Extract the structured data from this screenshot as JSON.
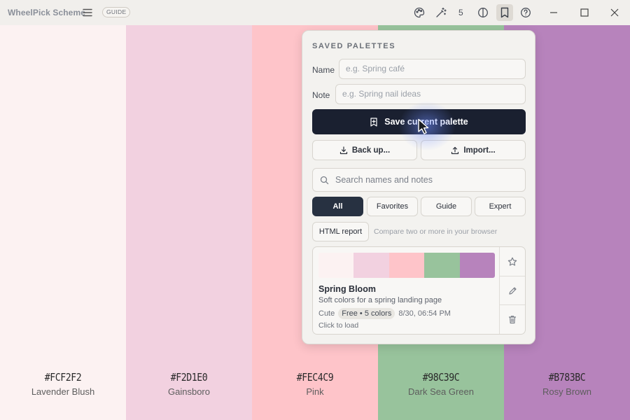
{
  "titlebar": {
    "app_title": "WheelPick Scheme",
    "guide_badge": "GUIDE",
    "saved_count": "5"
  },
  "swatches": [
    {
      "hex": "#FCF2F2",
      "name": "Lavender Blush",
      "color": "#FCF2F2"
    },
    {
      "hex": "#F2D1E0",
      "name": "Gainsboro",
      "color": "#F2D1E0"
    },
    {
      "hex": "#FEC4C9",
      "name": "Pink",
      "color": "#FEC4C9"
    },
    {
      "hex": "#98C39C",
      "name": "Dark Sea Green",
      "color": "#98C39C"
    },
    {
      "hex": "#B783BC",
      "name": "Rosy Brown",
      "color": "#B783BC"
    }
  ],
  "panel": {
    "title": "SAVED PALETTES",
    "name_label": "Name",
    "name_placeholder": "e.g. Spring café",
    "note_label": "Note",
    "note_placeholder": "e.g. Spring nail ideas",
    "save_label": "Save current palette",
    "backup_label": "Back up...",
    "import_label": "Import...",
    "search_placeholder": "Search names and notes",
    "filters": [
      "All",
      "Favorites",
      "Guide",
      "Expert"
    ],
    "report_label": "HTML report",
    "report_hint": "Compare two or more in your browser",
    "card": {
      "name": "Spring Bloom",
      "description": "Soft colors for a spring landing page",
      "tag": "Cute",
      "pill": "Free • 5 colors",
      "date": "8/30, 06:54 PM",
      "load_hint": "Click to load",
      "colors": [
        "#FCF2F2",
        "#F2D1E0",
        "#FEC4C9",
        "#98C39C",
        "#B783BC"
      ]
    }
  },
  "colors": {
    "primary_button": "#1A2030",
    "active_filter": "#273141"
  }
}
